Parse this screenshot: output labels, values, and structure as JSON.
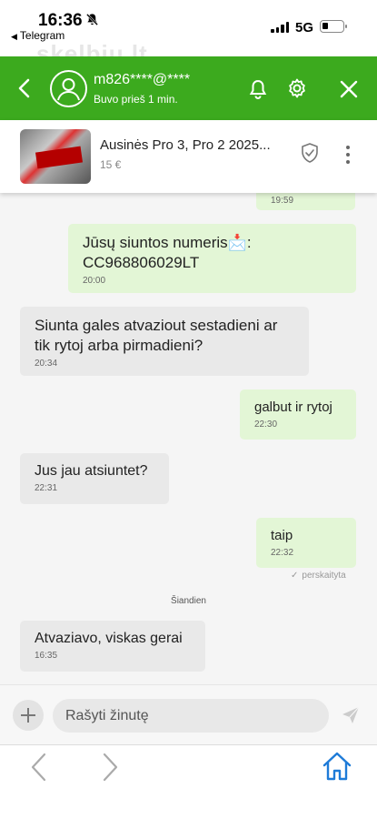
{
  "status_bar": {
    "time": "16:36",
    "back_app": "Telegram",
    "network": "5G"
  },
  "watermark": "skelbiu.lt",
  "header": {
    "username": "m826****@****",
    "status": "Buvo prieš 1 min.",
    "accent_color": "#3caa1e"
  },
  "listing": {
    "title": "Ausinės Pro 3, Pro 2 2025...",
    "price": "15 €"
  },
  "chat": {
    "messages": [
      {
        "direction": "out",
        "text": "",
        "time": "19:59"
      },
      {
        "direction": "out",
        "text": "Jūsų siuntos numeris📩:\nCC968806029LT",
        "time": "20:00"
      },
      {
        "direction": "in",
        "text": "Siunta gales atvaziout sestadieni ar tik rytoj arba pirmadieni?",
        "time": "20:34"
      },
      {
        "direction": "out",
        "text": "galbut ir rytoj",
        "time": "22:30"
      },
      {
        "direction": "in",
        "text": "Jus jau atsiuntet?",
        "time": "22:31"
      },
      {
        "direction": "out",
        "text": "taip",
        "time": "22:32",
        "receipt": "perskaityta"
      },
      {
        "direction": "in",
        "text": "Atvaziavo, viskas gerai",
        "time": "16:35"
      }
    ],
    "day_separator": "Šiandien",
    "bubble_out_color": "#e3f6d6",
    "bubble_in_color": "#e9e9e9"
  },
  "composer": {
    "placeholder": "Rašyti žinutę"
  },
  "icons": [
    "bell-muted-icon",
    "chevron-left-icon",
    "avatar-icon",
    "bell-icon",
    "gear-icon",
    "close-icon",
    "shield-check-icon",
    "more-vertical-icon",
    "plus-icon",
    "send-icon",
    "browser-back-icon",
    "browser-forward-icon",
    "home-icon"
  ]
}
